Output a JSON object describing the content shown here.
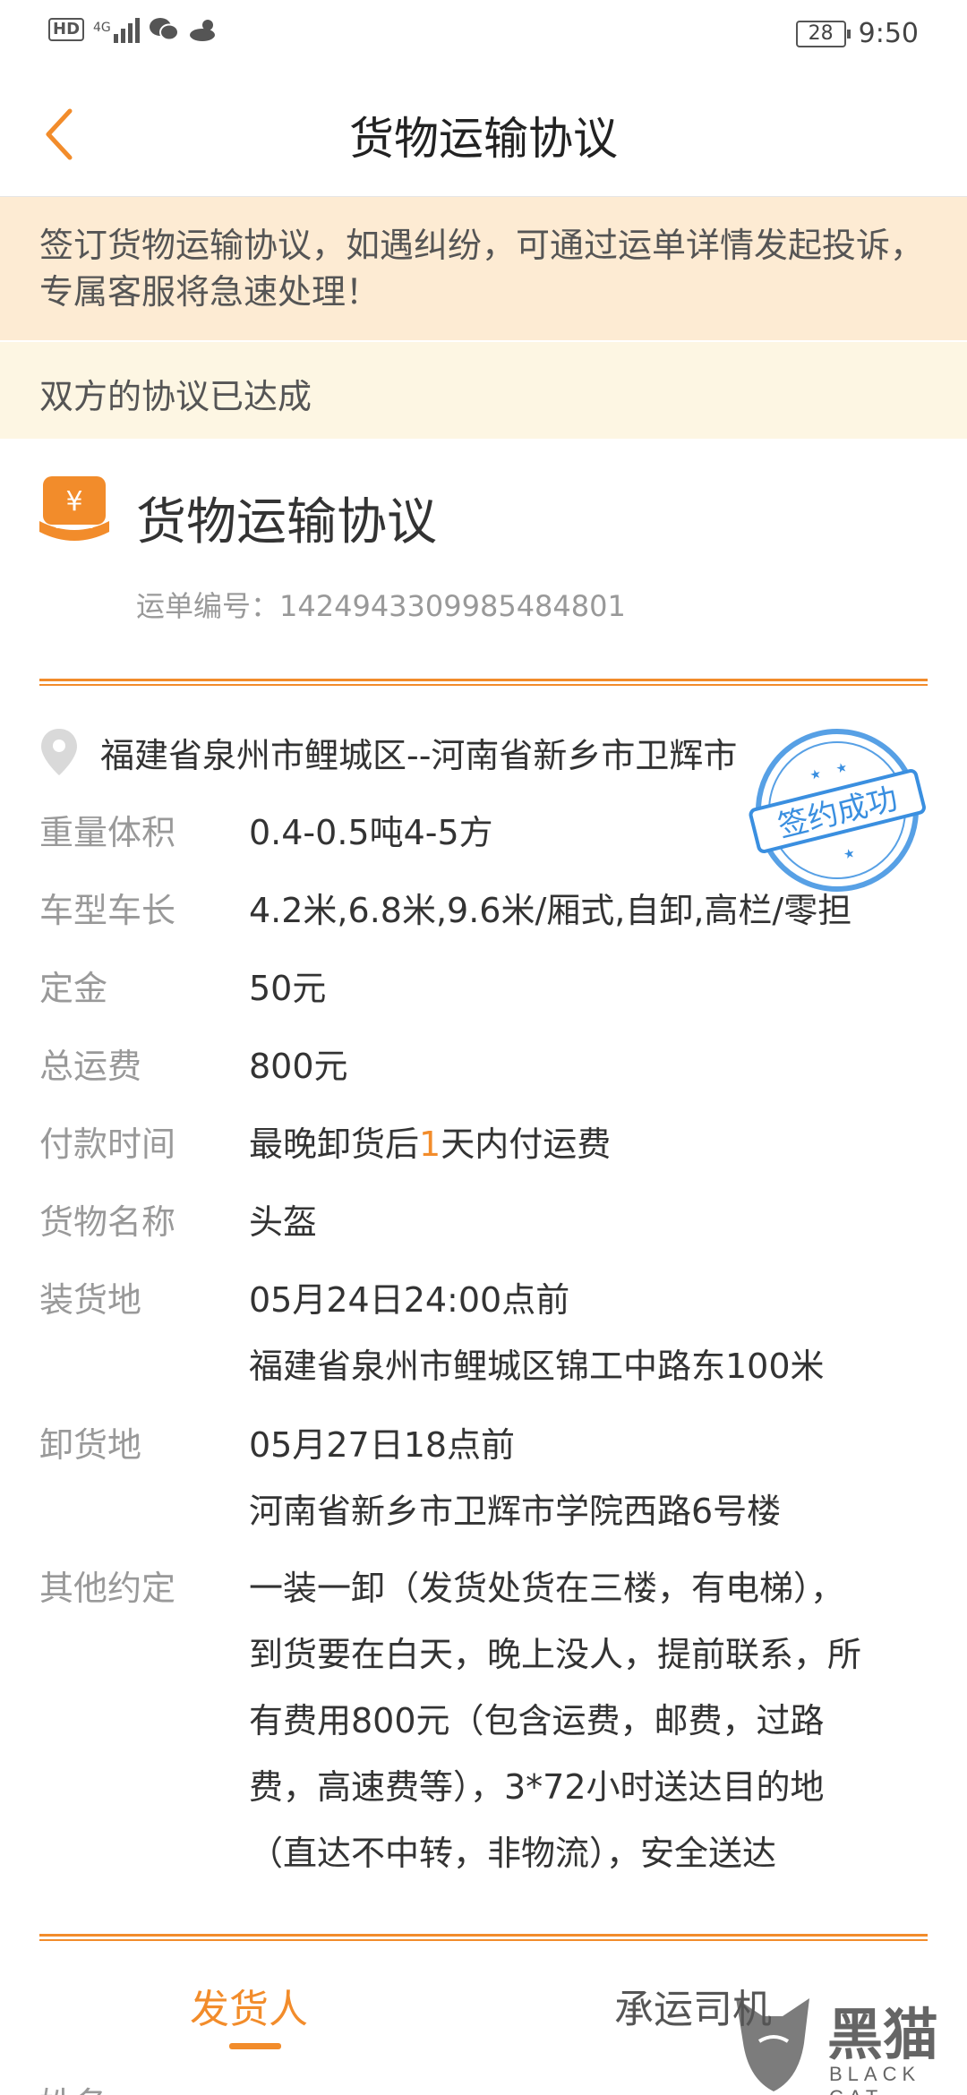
{
  "status_bar": {
    "hd": "HD",
    "network": "4G",
    "battery": "28",
    "time": "9:50"
  },
  "nav": {
    "title": "货物运输协议"
  },
  "notice": {
    "text": "签订货物运输协议，如遇纠纷，可通过运单详情发起投诉，专属客服将急速处理！"
  },
  "agreement_status": "双方的协议已达成",
  "contract": {
    "title": "货物运输协议",
    "waybill_label": "运单编号：",
    "waybill_number": "1424943309985484801",
    "icon_symbol": "¥",
    "route": "福建省泉州市鲤城区--河南省新乡市卫辉市",
    "stamp_text": "签约成功"
  },
  "details": [
    {
      "label": "重量体积",
      "value": "0.4-0.5吨4-5方"
    },
    {
      "label": "车型车长",
      "value": "4.2米,6.8米,9.6米/厢式,自卸,高栏/零担"
    },
    {
      "label": "定金",
      "value": "50元"
    },
    {
      "label": "总运费",
      "value": "800元"
    },
    {
      "label": "付款时间",
      "value_before": "最晚卸货后",
      "value_highlight": "1",
      "value_after": "天内付运费"
    },
    {
      "label": "货物名称",
      "value": "头盔"
    },
    {
      "label": "装货地",
      "line1": "05月24日24:00点前",
      "line2": "福建省泉州市鲤城区锦工中路东100米"
    },
    {
      "label": "卸货地",
      "line1": "05月27日18点前",
      "line2": "河南省新乡市卫辉市学院西路6号楼"
    },
    {
      "label": "其他约定",
      "lines": [
        "一装一卸（发货处货在三楼，有电梯），",
        "到货要在白天，晚上没人，提前联系，所",
        "有费用800元（包含运费，邮费，过路",
        "费，高速费等），3*72小时送达目的地",
        "（直达不中转，非物流），安全送达"
      ]
    }
  ],
  "tabs": {
    "shipper": "发货人",
    "driver": "承运司机"
  },
  "bottom_partial": "姓名",
  "watermark": {
    "text": "黑猫",
    "sub": "BLACK CAT"
  },
  "colors": {
    "accent": "#f28c2b",
    "notice_bg": "#fdebd3",
    "agreed_bg": "#fdf6e3",
    "stamp": "#3a8fe0"
  }
}
